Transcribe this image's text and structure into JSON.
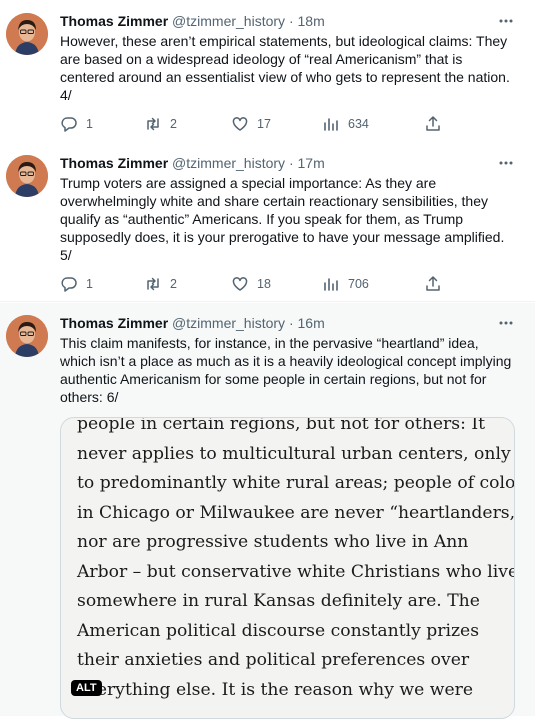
{
  "colors": {
    "muted": "#536471",
    "name": "#0f1419",
    "highlight_bg": "#f7f9f9"
  },
  "tweets": [
    {
      "author": "Thomas Zimmer",
      "handle": "@tzimmer_history",
      "separator": "·",
      "time": "18m",
      "lines": [
        "However, these aren’t empirical statements, but ideological claims: They",
        "are based on a widespread ideology of “real Americanism” that is",
        "centered around an essentialist view of who gets to represent the nation.",
        "4/"
      ],
      "replies": "1",
      "retweets": "2",
      "likes": "17",
      "views": "634"
    },
    {
      "author": "Thomas Zimmer",
      "handle": "@tzimmer_history",
      "separator": "·",
      "time": "17m",
      "lines": [
        "Trump voters are assigned a special importance: As they are",
        "overwhelmingly white and share certain reactionary sensibilities, they",
        "qualify as “authentic” Americans. If you speak for them, as Trump",
        "supposedly does, it is your prerogative to have your message amplified.",
        "5/"
      ],
      "replies": "1",
      "retweets": "2",
      "likes": "18",
      "views": "706"
    },
    {
      "author": "Thomas Zimmer",
      "handle": "@tzimmer_history",
      "separator": "·",
      "time": "16m",
      "lines": [
        "This claim manifests, for instance, in the pervasive “heartland” idea,",
        "which isn’t a place as much as it is a heavily ideological concept implying",
        "authentic Americanism for some people in certain regions, but not for",
        "others: 6/"
      ],
      "media_lines": [
        "people in certain regions, but not for others: It",
        "never applies to multicultural urban centers, only",
        "to predominantly white rural areas; people of color",
        "in Chicago or Milwaukee are never “heartlanders,”",
        "nor are progressive students who live in Ann",
        "Arbor – but conservative white Christians who live",
        "somewhere in rural Kansas definitely are. The",
        "American political discourse constantly prizes",
        "their anxieties and political preferences over",
        "everything else. It is the reason why we were"
      ],
      "alt_badge": "ALT"
    }
  ]
}
